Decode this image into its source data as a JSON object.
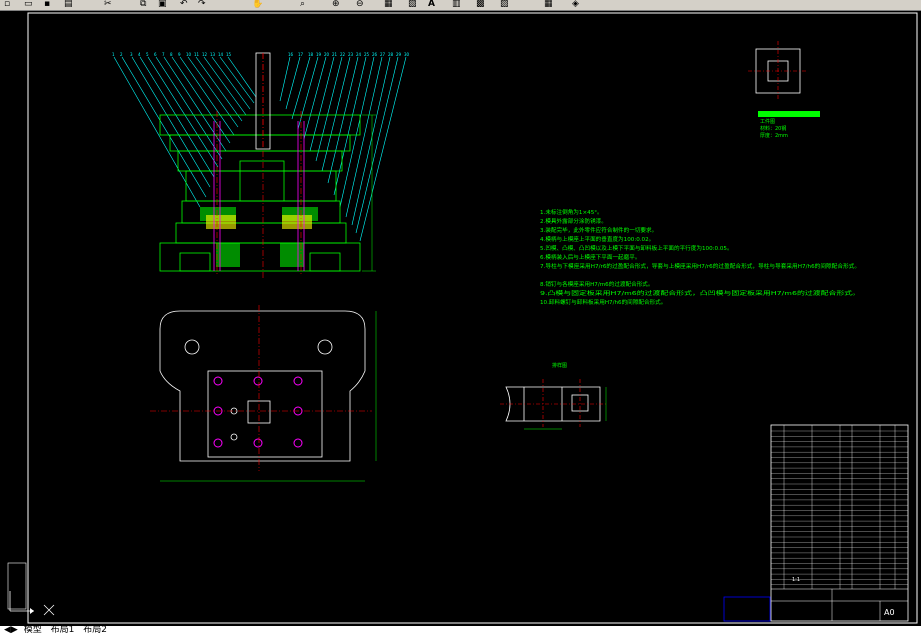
{
  "toolbar": {
    "icons": [
      "new-icon",
      "open-icon",
      "save-icon",
      "print-icon",
      "cut-icon",
      "copy-icon",
      "paste-icon",
      "undo-icon",
      "redo-icon",
      "pan-icon",
      "zoom-icon",
      "zoom-window-icon",
      "zoom-previous-icon",
      "properties-icon",
      "design-center-icon",
      "tool-palette-icon",
      "sheet-set-icon",
      "markup-icon",
      "calculator-icon",
      "layer-icon"
    ],
    "text_style_glyph": "A"
  },
  "colors": {
    "background": "#000000",
    "green": "#00ff00",
    "cyan": "#00ffff",
    "red": "#ff0000",
    "magenta": "#ff00ff",
    "yellow": "#ffff00",
    "white": "#ffffff",
    "blue": "#0000ff"
  },
  "drawing": {
    "title_block": {
      "scale": "1:1",
      "sheet_size": "A0"
    },
    "notes": [
      "1.未标注倒角为1×45°。",
      "2.模具外露部分涂防锈漆。",
      "3.装配完毕，此外零件应符合制件的一切要求。",
      "4.模柄与上模座上平面的垂直度为100:0.02。",
      "5.凹模、凸模、凸凹模以及上模下平面与卸料板上平面的平行度为100:0.05。",
      "6.模柄装入后与上模座下平面一起磨平。",
      "7.导柱与下模座采用H7/r6的过盈配合形式，导套与上模座采用H7/r6的过盈配合形式，导柱与导套采用H7/h6的间隙配合形式。",
      "8.销钉与各模座采用H7/m6的过渡配合形式。",
      "9.凸模与固定板采用H7/m6的过渡配合形式，凸凹模与固定板采用H7/m6的过渡配合形式。",
      "10.卸料螺钉与卸料板采用H7/h6的间隙配合形式。"
    ],
    "part_label": "工件图",
    "part_info": [
      "材料：20钢",
      "厚度：2mm"
    ],
    "strip_label": "排样图"
  },
  "statusbar": {
    "tabs": [
      "模型",
      "布局1",
      "布局2"
    ]
  }
}
